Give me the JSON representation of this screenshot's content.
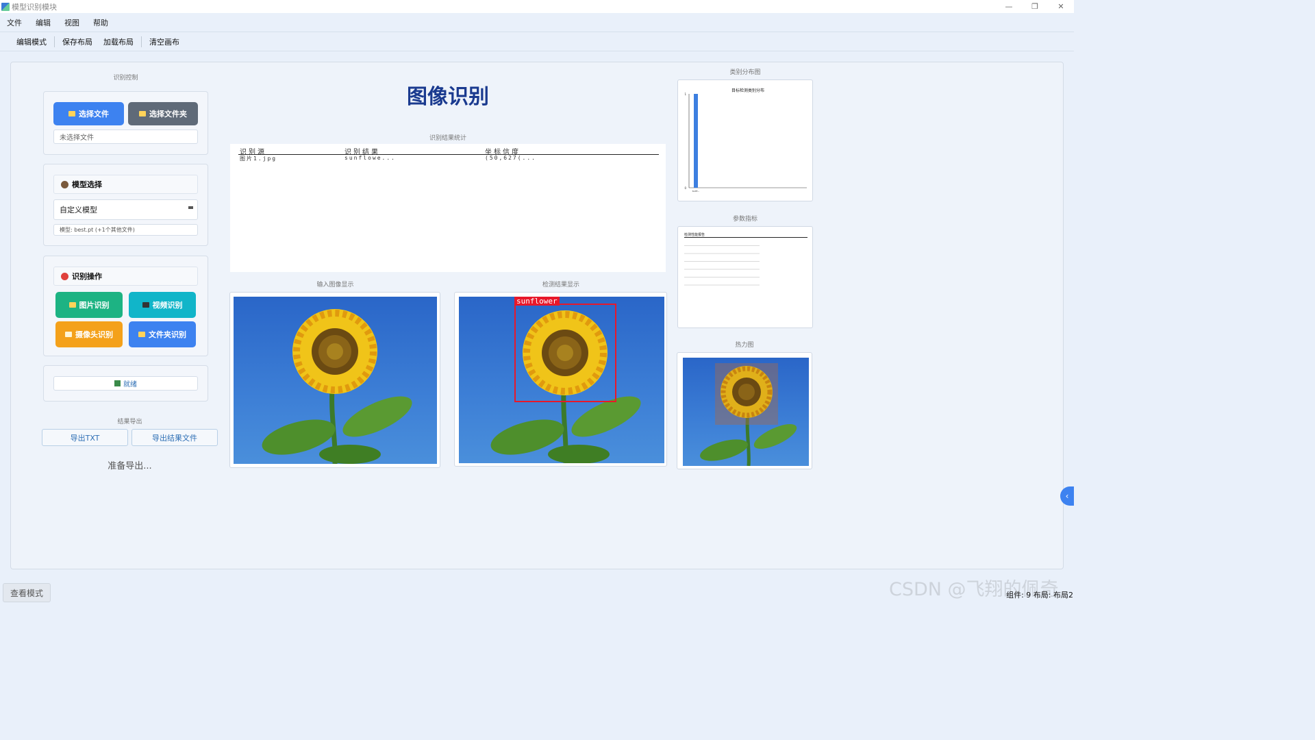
{
  "window": {
    "title": "模型识别模块"
  },
  "menu": [
    "文件",
    "编辑",
    "视图",
    "帮助"
  ],
  "toolbar": [
    "编辑模式",
    "保存布局",
    "加载布局",
    "清空画布"
  ],
  "left": {
    "control_label": "识别控制",
    "select_file": "选择文件",
    "select_folder": "选择文件夹",
    "file_status": "未选择文件",
    "model_header": "模型选择",
    "model_value": "自定义模型",
    "model_info": "模型: best.pt (+1个其他文件)",
    "ops_header": "识别操作",
    "image_detect": "图片识别",
    "video_detect": "视频识别",
    "camera_detect": "摄像头识别",
    "folder_detect": "文件夹识别",
    "status": "就绪",
    "export_label": "结果导出",
    "export_txt": "导出TXT",
    "export_result": "导出结果文件",
    "export_status": "准备导出..."
  },
  "center": {
    "title": "图像识别",
    "stats_label": "识别结果统计",
    "table_headers": [
      "识别源",
      "识别结果",
      "坐标信度"
    ],
    "table_rows": [
      [
        "图片1.jpg",
        "sunflowe...",
        "(50,627(..."
      ]
    ],
    "input_label": "输入图像显示",
    "result_label": "检测结果显示",
    "detection_tag": "sunflower"
  },
  "right": {
    "dist_label": "类别分布图",
    "dist_chart_title": "目标检测类别分布",
    "metrics_label": "参数指标",
    "metrics_title": "检测性能报告",
    "heatmap_label": "热力图"
  },
  "chart_data": {
    "type": "bar",
    "title": "目标检测类别分布",
    "categories": [
      "sunf..."
    ],
    "values": [
      1
    ],
    "ylim": [
      0,
      1
    ],
    "yticks": [
      "0",
      "1"
    ],
    "bar_color": "#3d7fe0"
  },
  "bottom": {
    "view_mode": "查看模式",
    "status_right": "组件: 9 布局: 布局2",
    "watermark": "CSDN @飞翔的佩奇"
  },
  "colors": {
    "blue": "#3d82f0",
    "gray": "#5f6a78",
    "green": "#1db383",
    "teal": "#11b5c9",
    "orange": "#f4a11a",
    "title_blue": "#1a3a8f"
  }
}
